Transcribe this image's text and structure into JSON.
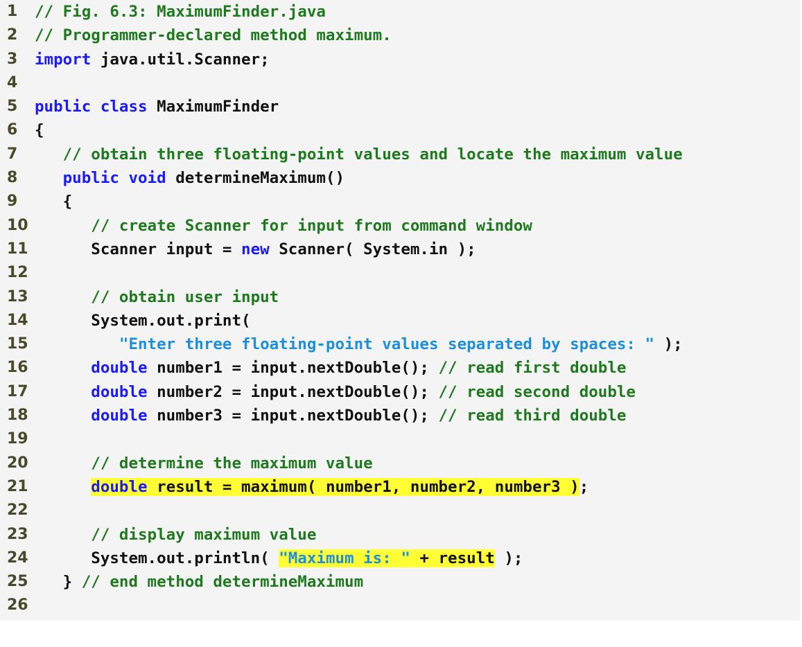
{
  "code_listing": {
    "colors": {
      "background": "#f4f4f4",
      "comment": "#1f7a1f",
      "keyword": "#1a1aff",
      "string": "#1e8fdc",
      "plain": "#111111",
      "line_number": "#4a4a2a",
      "highlight": "#ffff33"
    },
    "lines": [
      {
        "n": "1",
        "indent": "",
        "segments": [
          {
            "t": "// Fig. 6.3: MaximumFinder.java",
            "c": "cm"
          }
        ]
      },
      {
        "n": "2",
        "indent": "",
        "segments": [
          {
            "t": "// Programmer-declared method maximum.",
            "c": "cm"
          }
        ]
      },
      {
        "n": "3",
        "indent": "",
        "segments": [
          {
            "t": "import",
            "c": "kw"
          },
          {
            "t": " java.util.Scanner;",
            "c": "pl"
          }
        ]
      },
      {
        "n": "4",
        "indent": "",
        "segments": []
      },
      {
        "n": "5",
        "indent": "",
        "segments": [
          {
            "t": "public class",
            "c": "kw"
          },
          {
            "t": " MaximumFinder",
            "c": "pl"
          }
        ]
      },
      {
        "n": "6",
        "indent": "",
        "segments": [
          {
            "t": "{",
            "c": "pl"
          }
        ]
      },
      {
        "n": "7",
        "indent": "   ",
        "segments": [
          {
            "t": "// obtain three floating-point values and locate the maximum value",
            "c": "cm"
          }
        ]
      },
      {
        "n": "8",
        "indent": "   ",
        "segments": [
          {
            "t": "public void",
            "c": "kw"
          },
          {
            "t": " determineMaximum()",
            "c": "pl"
          }
        ]
      },
      {
        "n": "9",
        "indent": "   ",
        "segments": [
          {
            "t": "{",
            "c": "pl"
          }
        ]
      },
      {
        "n": "10",
        "indent": "      ",
        "segments": [
          {
            "t": "// create Scanner for input from command window",
            "c": "cm"
          }
        ]
      },
      {
        "n": "11",
        "indent": "      ",
        "segments": [
          {
            "t": "Scanner input = ",
            "c": "pl"
          },
          {
            "t": "new",
            "c": "kw"
          },
          {
            "t": " Scanner( System.in );",
            "c": "pl"
          }
        ]
      },
      {
        "n": "12",
        "indent": "",
        "segments": []
      },
      {
        "n": "13",
        "indent": "      ",
        "segments": [
          {
            "t": "// obtain user input",
            "c": "cm"
          }
        ]
      },
      {
        "n": "14",
        "indent": "      ",
        "segments": [
          {
            "t": "System.out.print(",
            "c": "pl"
          }
        ]
      },
      {
        "n": "15",
        "indent": "         ",
        "segments": [
          {
            "t": "\"Enter three floating-point values separated by spaces: \"",
            "c": "st"
          },
          {
            "t": " );",
            "c": "pl"
          }
        ]
      },
      {
        "n": "16",
        "indent": "      ",
        "segments": [
          {
            "t": "double",
            "c": "kw"
          },
          {
            "t": " number1 = input.nextDouble(); ",
            "c": "pl"
          },
          {
            "t": "// read first double",
            "c": "cm"
          }
        ]
      },
      {
        "n": "17",
        "indent": "      ",
        "segments": [
          {
            "t": "double",
            "c": "kw"
          },
          {
            "t": " number2 = input.nextDouble(); ",
            "c": "pl"
          },
          {
            "t": "// read second double",
            "c": "cm"
          }
        ]
      },
      {
        "n": "18",
        "indent": "      ",
        "segments": [
          {
            "t": "double",
            "c": "kw"
          },
          {
            "t": " number3 = input.nextDouble(); ",
            "c": "pl"
          },
          {
            "t": "// read third double",
            "c": "cm"
          }
        ]
      },
      {
        "n": "19",
        "indent": "",
        "segments": []
      },
      {
        "n": "20",
        "indent": "      ",
        "segments": [
          {
            "t": "// determine the maximum value",
            "c": "cm"
          }
        ]
      },
      {
        "n": "21",
        "indent": "      ",
        "segments": [
          {
            "t": "double",
            "c": "kw",
            "hl": true
          },
          {
            "t": " result = maximum( number1, number2, number3 )",
            "c": "pl",
            "hl": true
          },
          {
            "t": ";",
            "c": "pl"
          }
        ]
      },
      {
        "n": "22",
        "indent": "",
        "segments": []
      },
      {
        "n": "23",
        "indent": "      ",
        "segments": [
          {
            "t": "// display maximum value",
            "c": "cm"
          }
        ]
      },
      {
        "n": "24",
        "indent": "      ",
        "segments": [
          {
            "t": "System.out.println( ",
            "c": "pl"
          },
          {
            "t": "\"Maximum is: \"",
            "c": "st",
            "hl": true
          },
          {
            "t": " + result",
            "c": "pl",
            "hl": true
          },
          {
            "t": " );",
            "c": "pl"
          }
        ]
      },
      {
        "n": "25",
        "indent": "   ",
        "segments": [
          {
            "t": "} ",
            "c": "pl"
          },
          {
            "t": "// end method determineMaximum",
            "c": "cm"
          }
        ]
      },
      {
        "n": "26",
        "indent": "",
        "segments": []
      }
    ]
  }
}
